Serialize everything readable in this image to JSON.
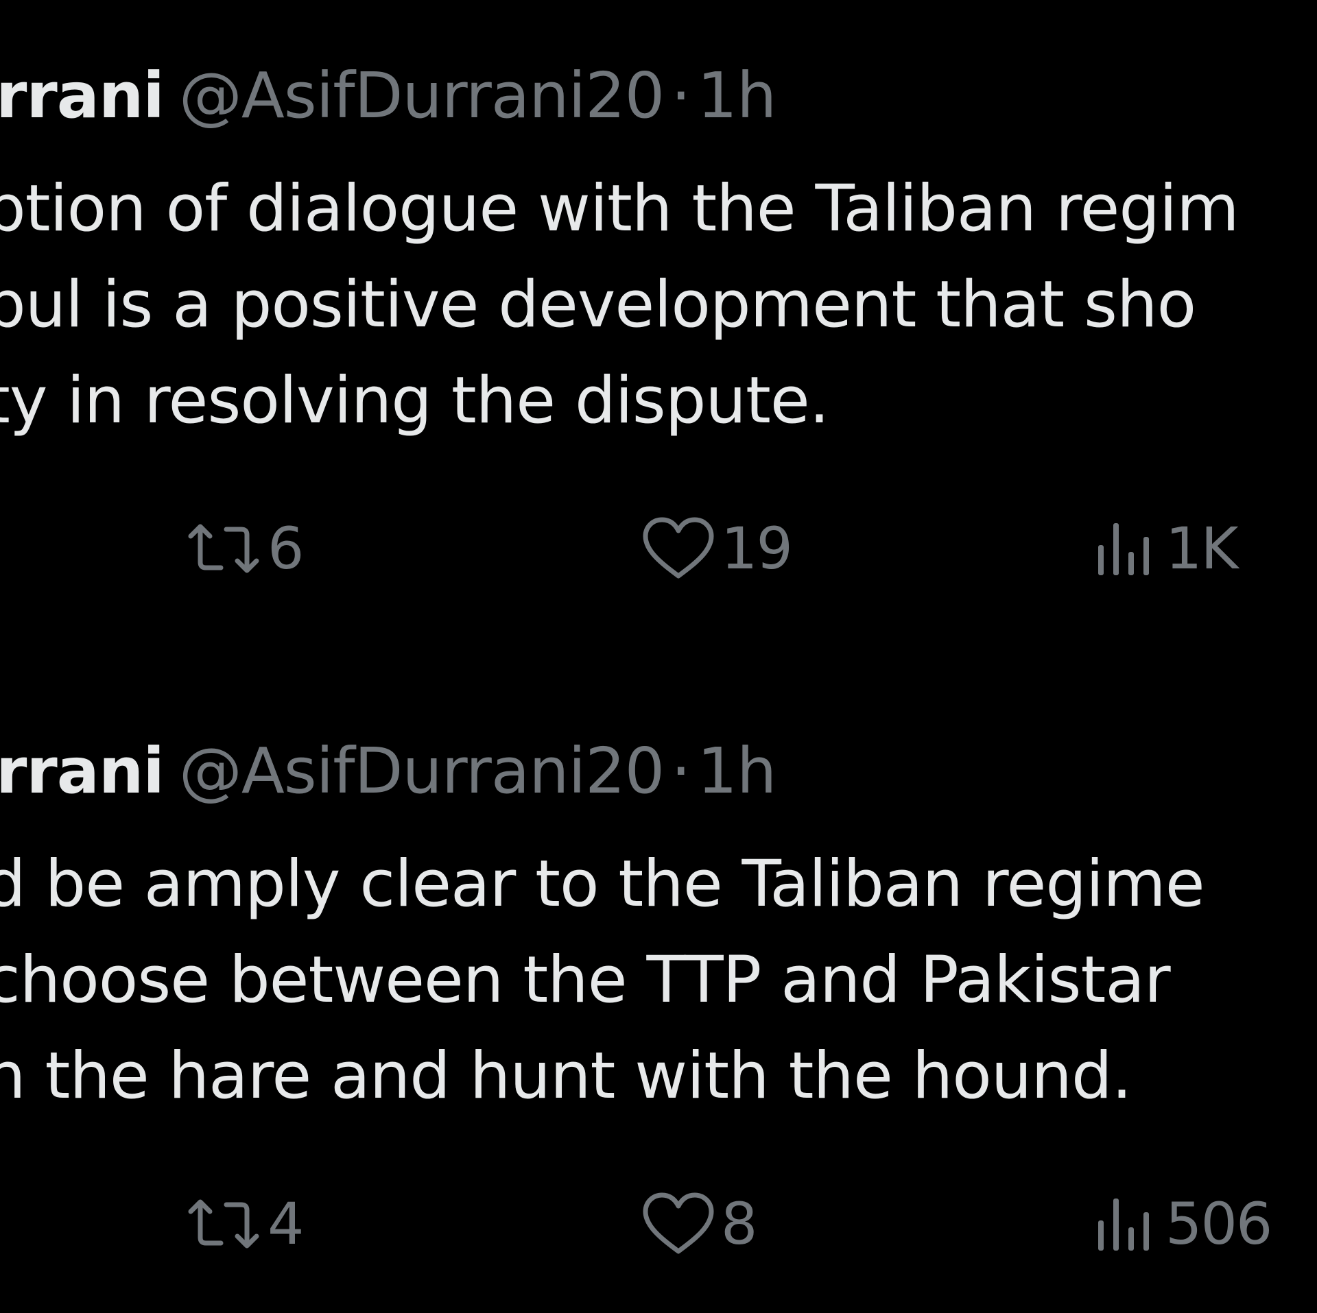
{
  "colors": {
    "background": "#000000",
    "text_primary": "#e7e9ea",
    "text_secondary": "#71767b"
  },
  "tweets": [
    {
      "author_name": "rrani",
      "handle": "@AsifDurrani20",
      "separator": "·",
      "time": "1h",
      "lines": [
        "ption of dialogue with the Taliban regim",
        "bul is a positive development that sho",
        "ty in resolving the dispute."
      ],
      "actions": {
        "retweet_icon": "retweet-icon",
        "retweets": "6",
        "like_icon": "heart-icon",
        "likes": "19",
        "views_icon": "views-bar-chart-icon",
        "views": "1K"
      }
    },
    {
      "author_name": "rrani",
      "handle": "@AsifDurrani20",
      "separator": "·",
      "time": "1h",
      "lines": [
        "d be amply clear to the Taliban regime",
        " choose between the TTP and Pakistar",
        "n the hare and hunt with the hound."
      ],
      "actions": {
        "retweet_icon": "retweet-icon",
        "retweets": "4",
        "like_icon": "heart-icon",
        "likes": "8",
        "views_icon": "views-bar-chart-icon",
        "views": "506"
      }
    }
  ]
}
